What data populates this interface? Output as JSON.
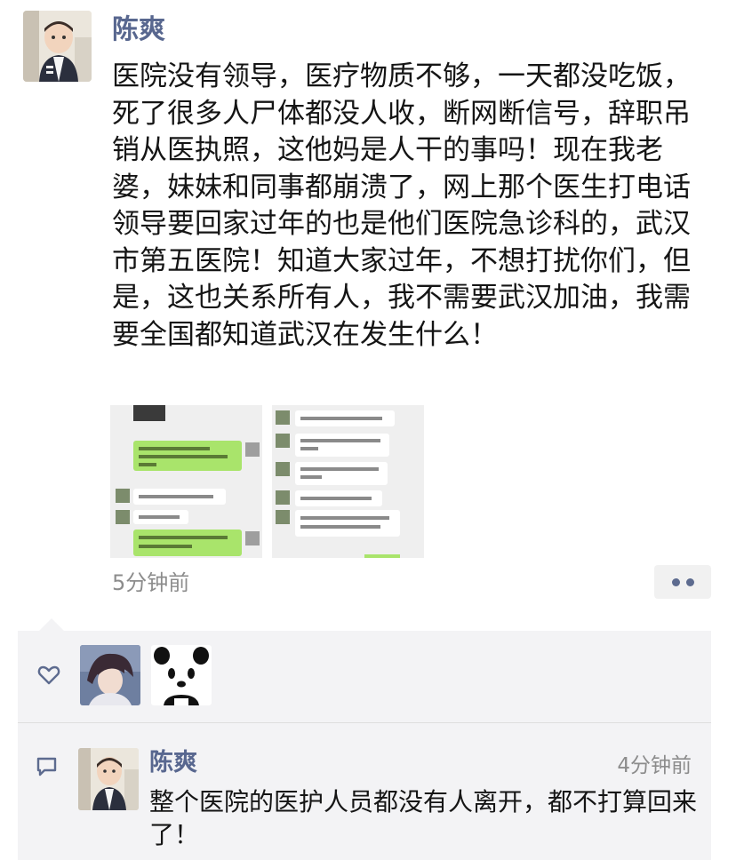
{
  "post": {
    "author": "陈爽",
    "text": "医院没有领导，医疗物质不够，一天都没吃饭，死了很多人尸体都没人收，断网断信号，辞职吊销从医执照，这他妈是人干的事吗！现在我老婆，妹妹和同事都崩溃了，网上那个医生打电话领导要回家过年的也是他们医院急诊科的，武汉市第五医院！知道大家过年，不想打扰你们，但是，这也关系所有人，我不需要武汉加油，我需要全国都知道武汉在发生什么！",
    "time": "5分钟前"
  },
  "comment": {
    "author": "陈爽",
    "time": "4分钟前",
    "text": "整个医院的医护人员都没有人离开，都不打算回来了！"
  },
  "icons": {
    "like": "heart-outline-icon",
    "comment": "comment-bubble-icon",
    "more": "more-dots-icon"
  },
  "colors": {
    "name": "#58678f",
    "timestamp": "#8c8c8c",
    "panel": "#f3f3f5",
    "bubble_green": "#a9e46b"
  }
}
